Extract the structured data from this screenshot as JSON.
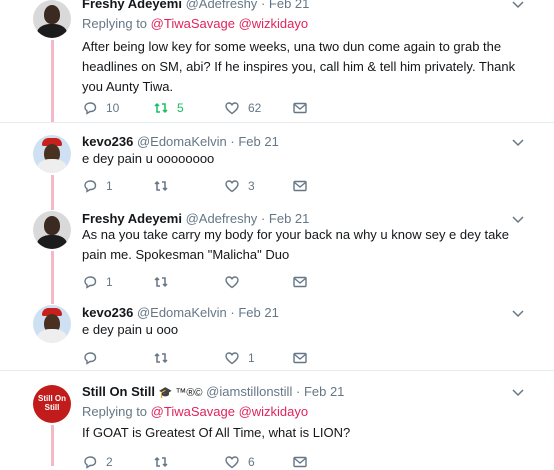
{
  "tweets": [
    {
      "name": "Freshy Adeyemi",
      "handle": "@Adefreshy",
      "time": "Feb 21",
      "replying_label": "Replying to",
      "mentions": [
        "@TiwaSavage",
        "@wizkidayo"
      ],
      "text": "After being low key for some weeks, una two dun come again to grab the headlines on SM, abi? If he inspires you, call him & tell him privately. Thank you Aunty Tiwa.",
      "replies": "10",
      "retweets": "5",
      "likes": "62",
      "avatar_icon": "user-avatar-photo"
    },
    {
      "name": "kevo236",
      "handle": "@EdomaKelvin",
      "time": "Feb 21",
      "text": "e dey pain u oooooooo",
      "replies": "1",
      "retweets": "",
      "likes": "3",
      "avatar_icon": "user-avatar-photo"
    },
    {
      "name": "Freshy Adeyemi",
      "handle": "@Adefreshy",
      "time": "Feb 21",
      "text": "As na you take carry my body for your back na  why u know sey e dey take pain me. Spokesman \"Malicha\" Duo",
      "replies": "1",
      "retweets": "",
      "likes": "",
      "avatar_icon": "user-avatar-photo"
    },
    {
      "name": "kevo236",
      "handle": "@EdomaKelvin",
      "time": "Feb 21",
      "text": "e dey pain u ooo",
      "replies": "",
      "retweets": "",
      "likes": "1",
      "avatar_icon": "user-avatar-photo"
    },
    {
      "name": "Still On Still",
      "name_emoji": "🎓 ™®©",
      "handle": "@iamstillonstill",
      "time": "Feb 21",
      "replying_label": "Replying to",
      "mentions": [
        "@TiwaSavage",
        "@wizkidayo"
      ],
      "text": "If GOAT is Greatest Of All Time, what is LION?",
      "replies": "2",
      "retweets": "",
      "likes": "6",
      "avatar_icon": "brand-logo",
      "avatar_logo_text": "Still On Still"
    }
  ],
  "colors": {
    "thread_line": "#f4b8c6",
    "mention": "#e0245e",
    "retweet_active": "#17bf63",
    "muted": "#657786"
  }
}
